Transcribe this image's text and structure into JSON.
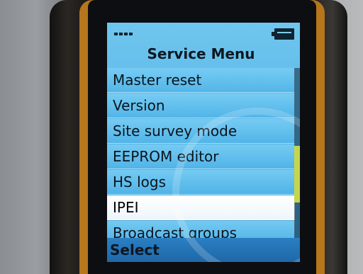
{
  "screen": {
    "title": "Service Menu",
    "menu_items": [
      {
        "label": "Master reset"
      },
      {
        "label": "Version"
      },
      {
        "label": "Site survey mode"
      },
      {
        "label": "EEPROM editor"
      },
      {
        "label": "HS logs"
      },
      {
        "label": "IPEI",
        "selected": true
      },
      {
        "label": "Broadcast groups"
      }
    ],
    "softkey": {
      "left_label": "Select"
    },
    "icons": {
      "signal": "signal-icon",
      "battery": "battery-icon"
    },
    "colors": {
      "screen_bg": "#5ab7e7",
      "highlight": "#ffffff",
      "softkey_bar": "#1f68a8",
      "scroll_thumb": "#c6d64a"
    }
  }
}
